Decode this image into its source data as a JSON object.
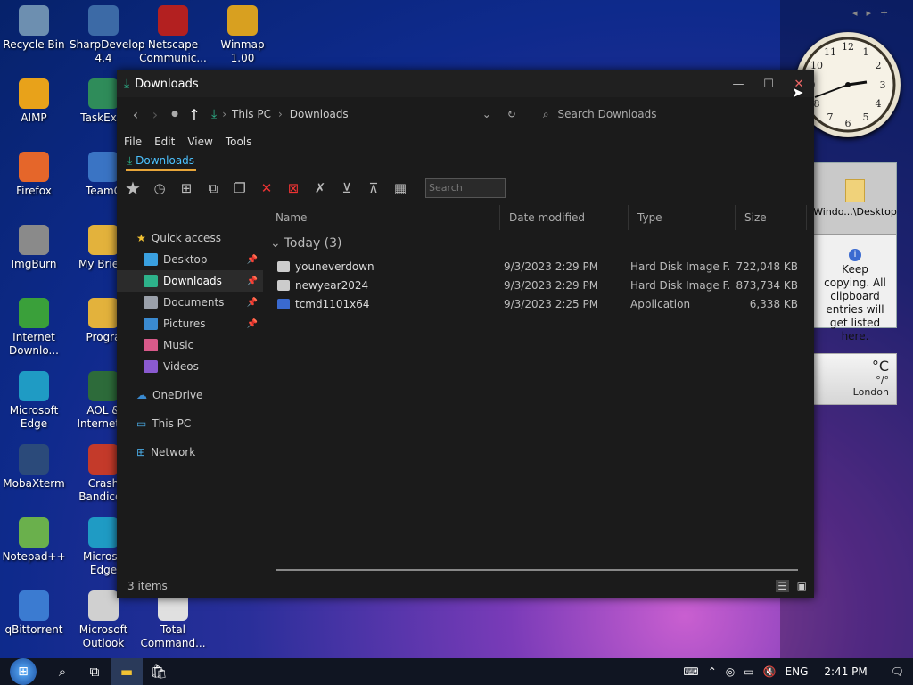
{
  "desktop_icons": [
    {
      "label": "Recycle Bin",
      "icon": "recycle-bin-icon",
      "color": "#6d8fb0"
    },
    {
      "label": "SharpDevelop 4.4",
      "icon": "sharpdevelop-icon",
      "color": "#3c6aa6"
    },
    {
      "label": "Netscape Communic...",
      "icon": "netscape-icon",
      "color": "#b32020"
    },
    {
      "label": "Winmap 1.00",
      "icon": "winamp-icon",
      "color": "#d8a020"
    },
    {
      "label": "AIMP",
      "icon": "aimp-icon",
      "color": "#e8a21a"
    },
    {
      "label": "TaskExpl",
      "icon": "taskexplorer-icon",
      "color": "#2f8c5a"
    },
    {
      "label": "Firefox",
      "icon": "firefox-icon",
      "color": "#e5662a"
    },
    {
      "label": "TeamC",
      "icon": "teamcity-icon",
      "color": "#3a74c4"
    },
    {
      "label": "ImgBurn",
      "icon": "imgburn-icon",
      "color": "#8a8a8a"
    },
    {
      "label": "My Briefc",
      "icon": "briefcase-icon",
      "color": "#e3b23c"
    },
    {
      "label": "Internet Downlo...",
      "icon": "idm-icon",
      "color": "#3aa03a"
    },
    {
      "label": "Progra",
      "icon": "program-icon",
      "color": "#e3b23c"
    },
    {
      "label": "Microsoft Edge",
      "icon": "edge-icon",
      "color": "#1f9bc4"
    },
    {
      "label": "AOL & Internet E",
      "icon": "aol-icon",
      "color": "#2d6b3a"
    },
    {
      "label": "MobaXterm",
      "icon": "mobaxterm-icon",
      "color": "#2b4a7a"
    },
    {
      "label": "Crash Bandicoo",
      "icon": "crash-icon",
      "color": "#c43a2a"
    },
    {
      "label": "Notepad++",
      "icon": "notepadpp-icon",
      "color": "#6ab04c"
    },
    {
      "label": "Microso Edge",
      "icon": "edge-icon",
      "color": "#1f9bc4"
    },
    {
      "label": "qBittorrent",
      "icon": "qbittorrent-icon",
      "color": "#3b7bd1"
    },
    {
      "label": "Microsoft Outlook",
      "icon": "outlook-icon",
      "color": "#d0d0d0"
    },
    {
      "label": "Total Command...",
      "icon": "totalcommander-icon",
      "color": "#e0e0e0"
    }
  ],
  "gadgets": {
    "clipboard_title": "Windo...\\Desktop",
    "clipboard_text": "Keep copying. All clipboard entries will get listed here.",
    "weather_temp": "°C",
    "weather_sub": "°/°",
    "weather_city": "London"
  },
  "window": {
    "title": "Downloads",
    "breadcrumb": [
      "This PC",
      "Downloads"
    ],
    "search_placeholder": "Search Downloads",
    "menu": [
      "File",
      "Edit",
      "View",
      "Tools"
    ],
    "tab": "Downloads",
    "toolbar_search": "Search"
  },
  "nav": {
    "quick_access": "Quick access",
    "items": [
      {
        "label": "Desktop",
        "color": "#3aa0e0",
        "pinned": true
      },
      {
        "label": "Downloads",
        "color": "#2db28a",
        "pinned": true,
        "selected": true
      },
      {
        "label": "Documents",
        "color": "#9aa0aa",
        "pinned": true
      },
      {
        "label": "Pictures",
        "color": "#3a8ad0",
        "pinned": true
      },
      {
        "label": "Music",
        "color": "#d85a8a",
        "pinned": false
      },
      {
        "label": "Videos",
        "color": "#8a5ad0",
        "pinned": false
      }
    ],
    "onedrive": "OneDrive",
    "this_pc": "This PC",
    "network": "Network"
  },
  "columns": [
    "Name",
    "Date modified",
    "Type",
    "Size"
  ],
  "group": "Today (3)",
  "files": [
    {
      "name": "youneverdown",
      "date": "9/3/2023 2:29 PM",
      "type": "Hard Disk Image F...",
      "size": "722,048 KB"
    },
    {
      "name": "newyear2024",
      "date": "9/3/2023 2:29 PM",
      "type": "Hard Disk Image F...",
      "size": "873,734 KB"
    },
    {
      "name": "tcmd1101x64",
      "date": "9/3/2023 2:25 PM",
      "type": "Application",
      "size": "6,338 KB"
    }
  ],
  "status": "3 items",
  "taskbar": {
    "lang": "ENG",
    "time": "2:41 PM"
  }
}
